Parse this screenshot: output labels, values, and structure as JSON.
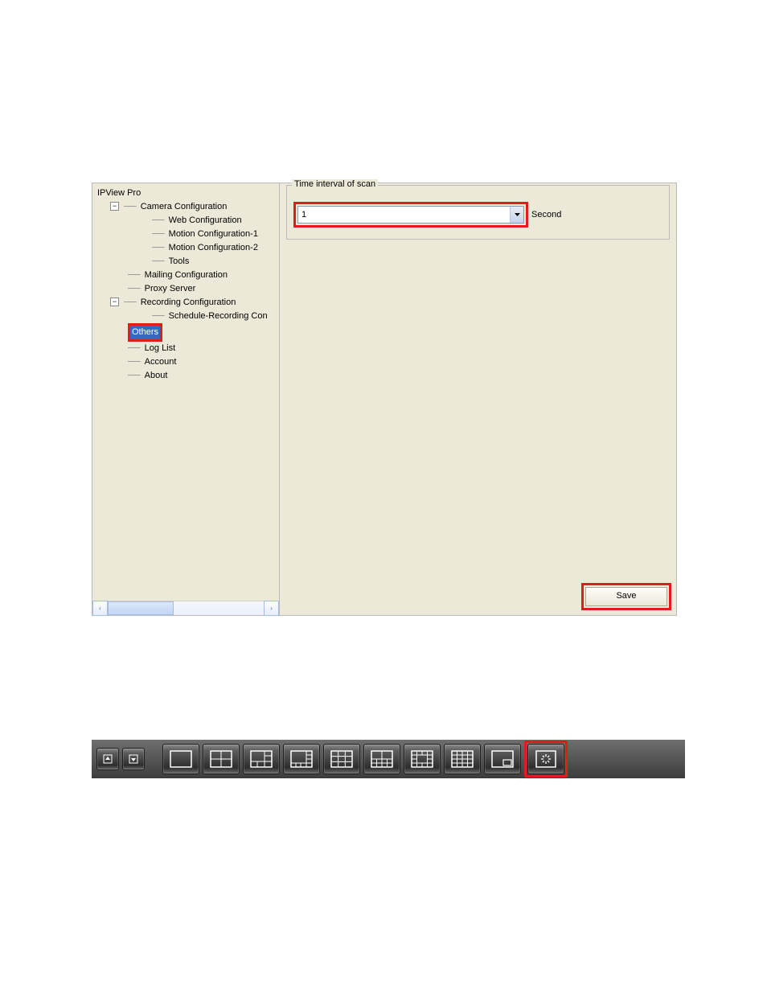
{
  "tree": {
    "root": "IPView Pro",
    "camera_config": "Camera Configuration",
    "web_config": "Web Configuration",
    "motion_config_1": "Motion Configuration-1",
    "motion_config_2": "Motion Configuration-2",
    "tools": "Tools",
    "mailing_config": "Mailing Configuration",
    "proxy_server": "Proxy Server",
    "recording_config": "Recording Configuration",
    "schedule_recording": "Schedule-Recording Con",
    "others": "Others",
    "log_list": "Log List",
    "account": "Account",
    "about": "About"
  },
  "groupbox": {
    "title": "Time interval of scan",
    "interval_value": "1",
    "unit_label": "Second"
  },
  "buttons": {
    "save_label": "Save"
  },
  "toolbar": {
    "items": [
      "page-up",
      "page-down",
      "layout-1",
      "layout-4",
      "layout-6",
      "layout-8",
      "layout-9",
      "layout-10",
      "layout-13",
      "layout-16",
      "layout-pip",
      "scan"
    ]
  }
}
